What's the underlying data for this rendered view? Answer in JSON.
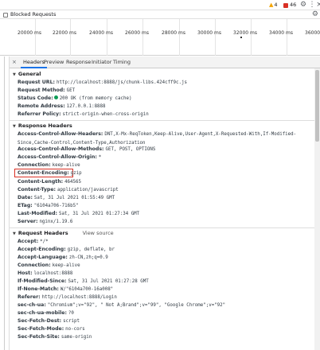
{
  "topbar": {
    "warnings_count": "4",
    "errors_count": "46",
    "settings_icon": "gear-icon",
    "menu_icon": "kebab-menu-icon",
    "close_icon": "close-icon"
  },
  "filterbar": {
    "blocked_requests_label": "Blocked Requests",
    "blocked_requests_checked": false,
    "settings_icon": "gear-icon"
  },
  "timeline": {
    "ticks": [
      "20000 ms",
      "22000 ms",
      "24000 ms",
      "26000 ms",
      "28000 ms",
      "30000 ms",
      "32000 ms",
      "34000 ms",
      "36000 m"
    ]
  },
  "tabs": {
    "close": "×",
    "items": [
      "Headers",
      "Preview",
      "Response",
      "Initiator",
      "Timing"
    ],
    "active": "Headers"
  },
  "general": {
    "title": "General",
    "rows": [
      {
        "k": "Request URL:",
        "v": "http://localhost:8888/js/chunk-libs.424cff9c.js"
      },
      {
        "k": "Request Method:",
        "v": "GET"
      },
      {
        "k": "Status Code:",
        "v": "200 OK (from memory cache)"
      },
      {
        "k": "Remote Address:",
        "v": "127.0.0.1:8888"
      },
      {
        "k": "Referrer Policy:",
        "v": "strict-origin-when-cross-origin"
      }
    ]
  },
  "response_headers": {
    "title": "Response Headers",
    "rows": [
      {
        "k": "Access-Control-Allow-Headers:",
        "v": "DNT,X-Mx-ReqToken,Keep-Alive,User-Agent,X-Requested-With,If-Modified-Since,Cache-Control,Content-Type,Authorization"
      },
      {
        "k": "Access-Control-Allow-Methods:",
        "v": "GET, POST, OPTIONS"
      },
      {
        "k": "Access-Control-Allow-Origin:",
        "v": "*"
      },
      {
        "k": "Connection:",
        "v": "keep-alive"
      },
      {
        "k": "Content-Encoding:",
        "v": "gzip"
      },
      {
        "k": "Content-Length:",
        "v": "464565"
      },
      {
        "k": "Content-Type:",
        "v": "application/javascript"
      },
      {
        "k": "Date:",
        "v": "Sat, 31 Jul 2021 01:55:49 GMT"
      },
      {
        "k": "ETag:",
        "v": "\"6104a706-716b5\""
      },
      {
        "k": "Last-Modified:",
        "v": "Sat, 31 Jul 2021 01:27:34 GMT"
      },
      {
        "k": "Server:",
        "v": "nginx/1.19.6"
      }
    ]
  },
  "request_headers": {
    "title": "Request Headers",
    "view_source": "View source",
    "rows": [
      {
        "k": "Accept:",
        "v": "*/*"
      },
      {
        "k": "Accept-Encoding:",
        "v": "gzip, deflate, br"
      },
      {
        "k": "Accept-Language:",
        "v": "zh-CN,zh;q=0.9"
      },
      {
        "k": "Connection:",
        "v": "keep-alive"
      },
      {
        "k": "Host:",
        "v": "localhost:8888"
      },
      {
        "k": "If-Modified-Since:",
        "v": "Sat, 31 Jul 2021 01:27:28 GMT"
      },
      {
        "k": "If-None-Match:",
        "v": "W/\"6104a700-16a008\""
      },
      {
        "k": "Referer:",
        "v": "http://localhost:8888/Login"
      },
      {
        "k": "sec-ch-ua:",
        "v": "\"Chromium\";v=\"92\", \" Not A;Brand\";v=\"99\", \"Google Chrome\";v=\"92\""
      },
      {
        "k": "sec-ch-ua-mobile:",
        "v": "?0"
      },
      {
        "k": "Sec-Fetch-Dest:",
        "v": "script"
      },
      {
        "k": "Sec-Fetch-Mode:",
        "v": "no-cors"
      },
      {
        "k": "Sec-Fetch-Site:",
        "v": "same-origin"
      }
    ]
  },
  "colors": {
    "accent": "#1a73e8",
    "status_ok": "#0f9d58",
    "highlight": "#d93025",
    "warning": "#f4a400"
  }
}
